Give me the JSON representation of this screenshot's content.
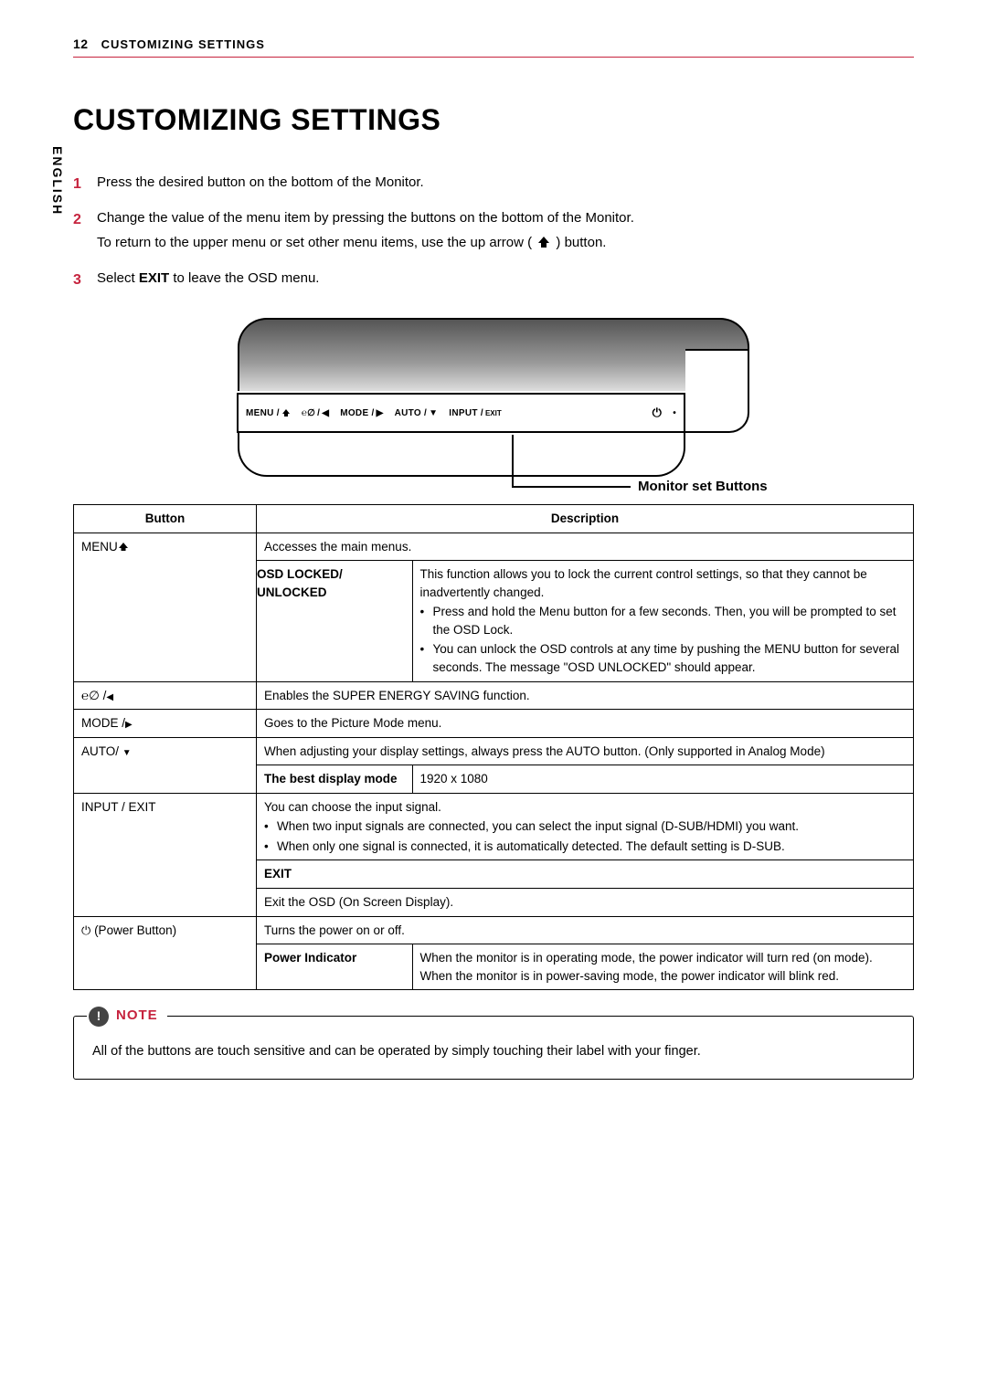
{
  "page": {
    "number": "12",
    "header": "CUSTOMIZING SETTINGS",
    "language": "ENGLISH",
    "h1": "CUSTOMIZING SETTINGS"
  },
  "steps": {
    "s1": "Press the desired button on the bottom of the Monitor.",
    "s2a": "Change the value of the menu item by pressing the buttons on the bottom of the Monitor.",
    "s2b_pre": "To return to the upper menu or set other menu items, use the up arrow (",
    "s2b_post": ") button.",
    "s3_pre": "Select ",
    "s3_bold": "EXIT",
    "s3_post": " to leave the OSD menu."
  },
  "diagram": {
    "labels": {
      "menu": "MENU /",
      "energy": "/",
      "mode": "MODE /",
      "auto": "AUTO /",
      "input": "INPUT /",
      "exit": "EXIT"
    },
    "callout": "Monitor set Buttons"
  },
  "table": {
    "head_button": "Button",
    "head_desc": "Description",
    "rows": {
      "menu": {
        "btn": "MENU",
        "desc": "Accesses the main menus."
      },
      "osd": {
        "label": "OSD LOCKED/ UNLOCKED",
        "desc_p1": "This function allows you to lock the current control settings, so that they cannot be inadvertently changed.",
        "b1": "Press and hold the Menu button for a few seconds. Then, you will be prompted to set the OSD Lock.",
        "b2": "You can unlock the OSD controls at any time by pushing the MENU button for several seconds. The message \"OSD UNLOCKED\" should appear."
      },
      "energy": {
        "btn": "/",
        "desc": "Enables the SUPER ENERGY SAVING function."
      },
      "mode": {
        "btn": "MODE /",
        "desc": "Goes to the Picture Mode menu."
      },
      "auto": {
        "btn": "AUTO/",
        "desc": "When adjusting your display settings, always press the AUTO button. (Only supported in Analog Mode)"
      },
      "best": {
        "label": "The best display mode",
        "value": "1920 x 1080"
      },
      "input": {
        "btn": "INPUT / EXIT",
        "p1": "You can choose the input signal.",
        "b1": "When two input signals are connected, you can select the input signal (D-SUB/HDMI) you want.",
        "b2": "When only one signal is connected, it is automatically detected. The default setting is D-SUB."
      },
      "exit": {
        "label": "EXIT",
        "desc": "Exit the OSD (On Screen Display)."
      },
      "power": {
        "btn": "(Power Button)",
        "desc": "Turns the power on or off."
      },
      "pind": {
        "label": "Power Indicator",
        "p1": "When the monitor is in operating mode, the power indicator will turn red (on mode).",
        "p2": "When the monitor is in power-saving mode, the power indicator will blink red."
      }
    }
  },
  "note": {
    "title": "NOTE",
    "body": "All of the buttons are touch sensitive and can be operated by simply touching their label with your finger."
  }
}
